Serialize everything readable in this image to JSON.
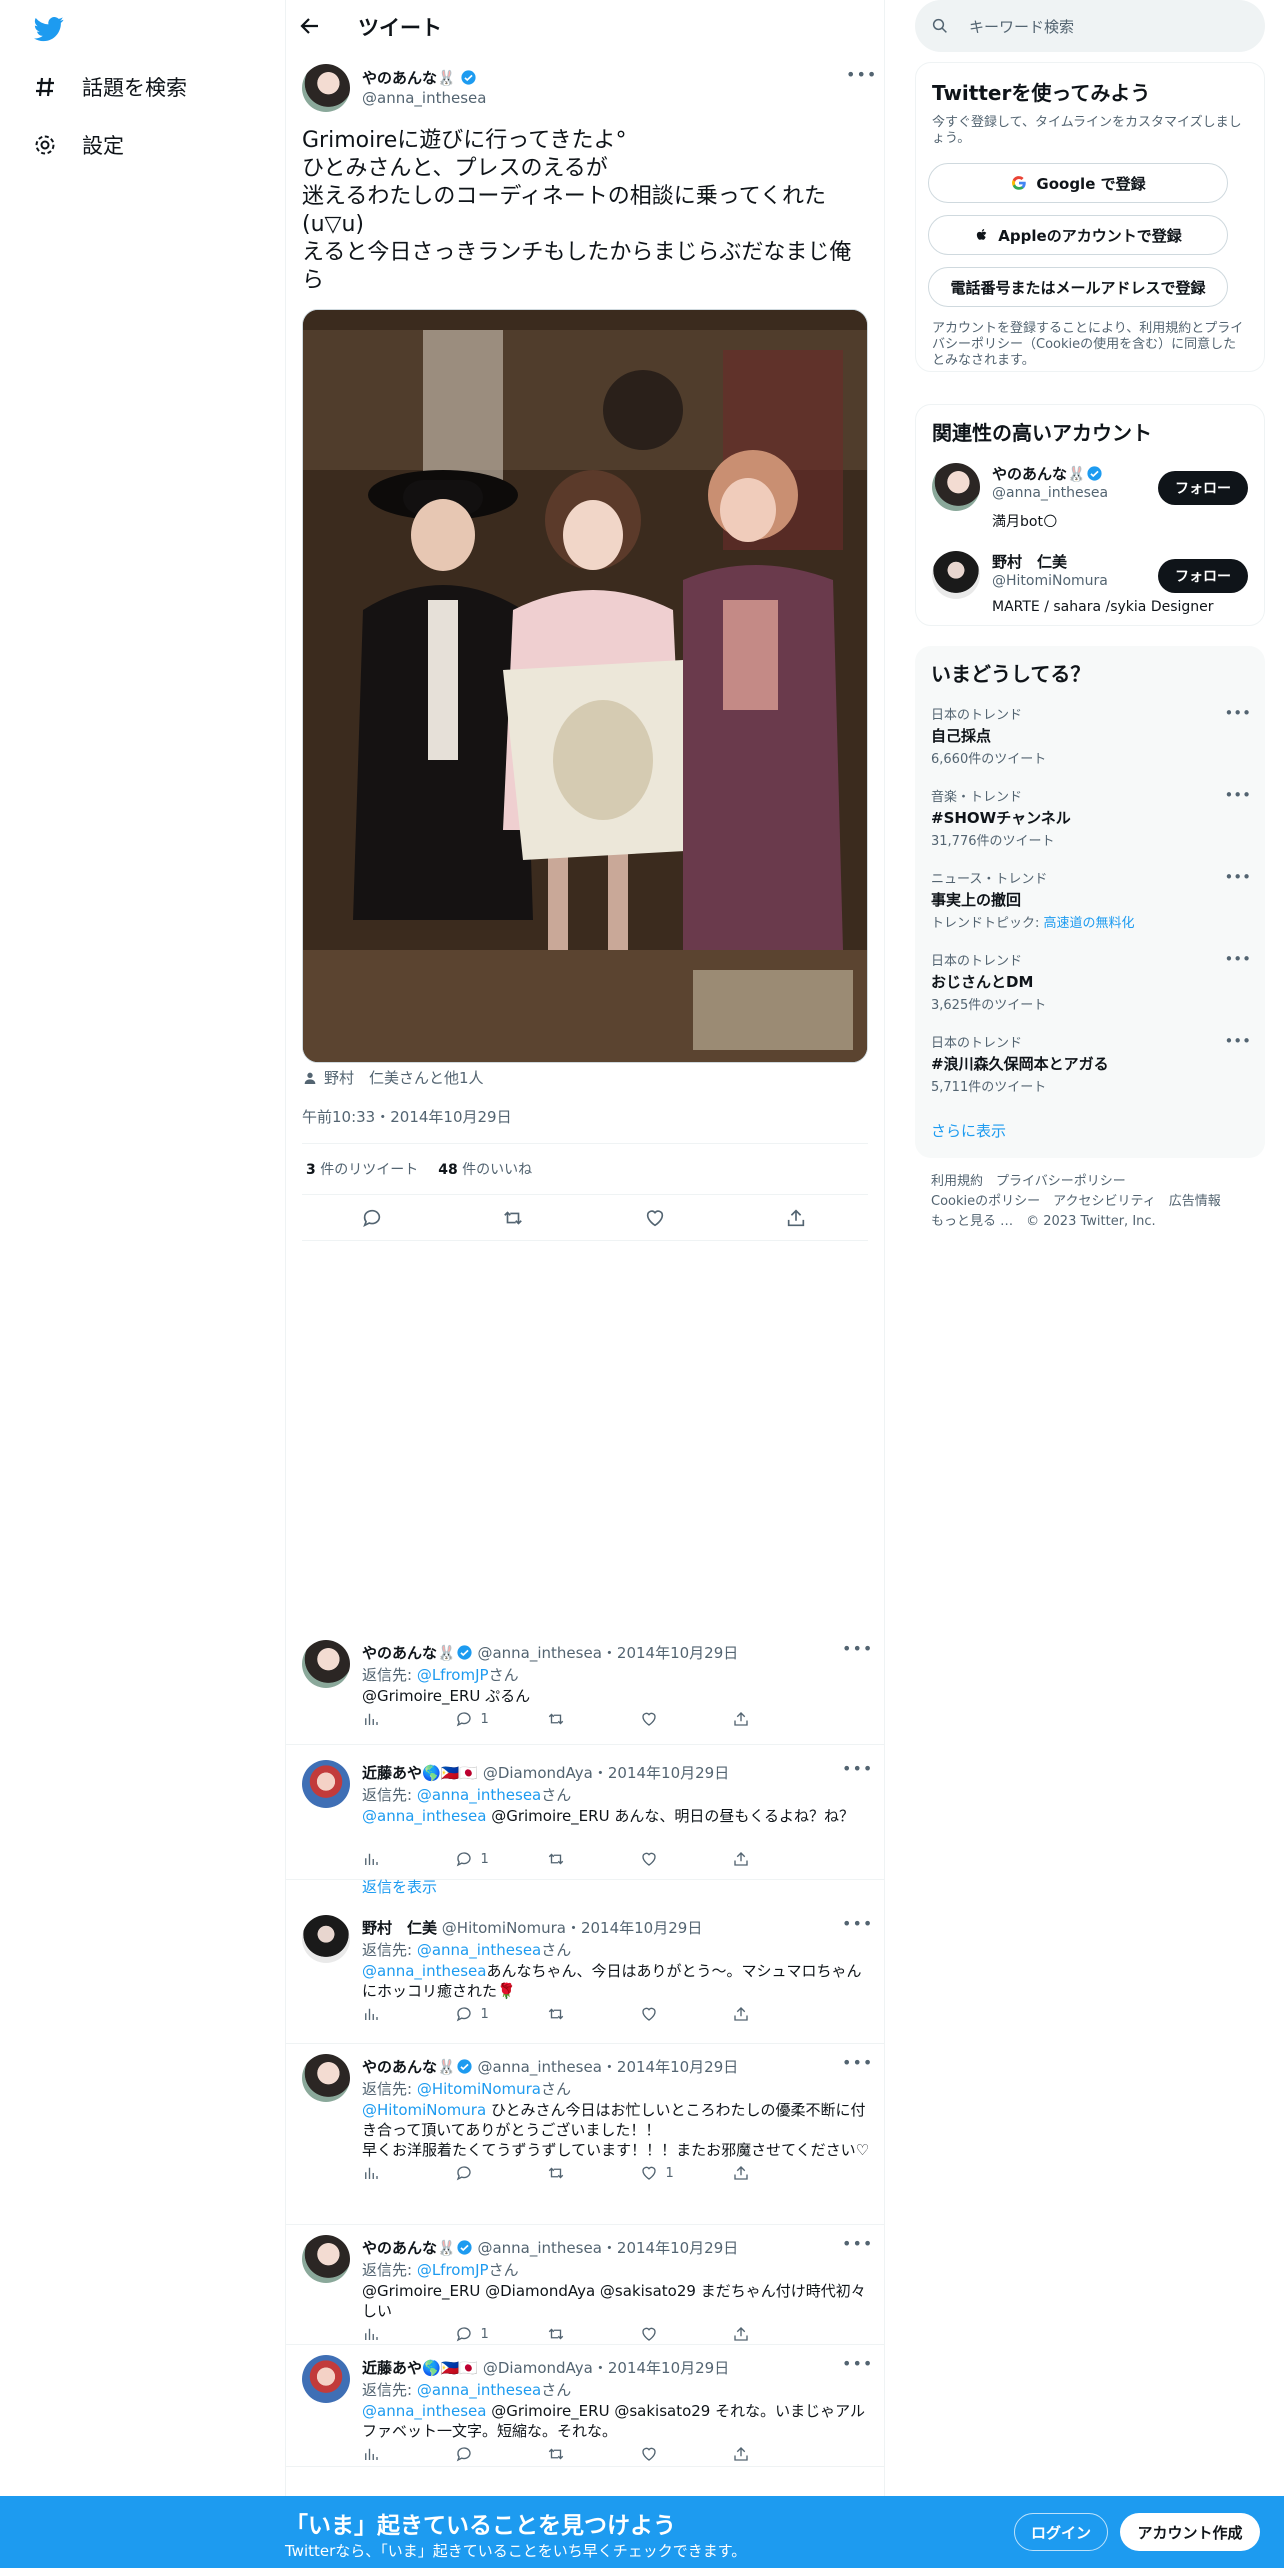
{
  "nav": {
    "explore_label": "話題を検索",
    "settings_label": "設定"
  },
  "header": {
    "title": "ツイート"
  },
  "tweet": {
    "author_name": "やのあんな🐰",
    "author_handle": "@anna_inthesea",
    "text": "Grimoireに遊びに行ってきたよ°\nひとみさんと、プレスのえるが\n迷えるわたしのコーディネートの相談に乗ってくれた(u▽u)\nえると今日さっきランチもしたからまじらぶだなまじ俺ら",
    "tagged": "野村　仁美さんと他1人",
    "time": "午前10:33・2014年10月29日",
    "retweets_count": "3",
    "retweets_label": "件のリツイート",
    "likes_count": "48",
    "likes_label": "件のいいね"
  },
  "replies": [
    {
      "name": "やのあんな🐰",
      "handle": "@anna_inthesea",
      "date": "・2014年10月29日",
      "replyto_prefix": "返信先: ",
      "replyto": "@LfromJP",
      "replyto_suffix": "さん",
      "mention": "",
      "body": "@Grimoire_ERU ぷるん",
      "reply_count": "1",
      "like_count": ""
    },
    {
      "name": "近藤あや🌎🇵🇭🇯🇵",
      "handle": "@DiamondAya",
      "date": "・2014年10月29日",
      "replyto_prefix": "返信先: ",
      "replyto": "@anna_inthesea",
      "replyto_suffix": "さん",
      "mention": "@anna_inthesea",
      "body": " @Grimoire_ERU あんな、明日の昼もくるよね？ね？",
      "reply_count": "1",
      "like_count": ""
    },
    {
      "name": "野村　仁美",
      "handle": "@HitomiNomura",
      "date": "・2014年10月29日",
      "replyto_prefix": "返信先: ",
      "replyto": "@anna_inthesea",
      "replyto_suffix": "さん",
      "mention": "@anna_inthesea",
      "body": "あんなちゃん、今日はありがとう〜。マシュマロちゃんにホッコリ癒された🌹",
      "reply_count": "1",
      "like_count": ""
    },
    {
      "name": "やのあんな🐰",
      "handle": "@anna_inthesea",
      "date": "・2014年10月29日",
      "replyto_prefix": "返信先: ",
      "replyto": "@HitomiNomura",
      "replyto_suffix": "さん",
      "mention": "@HitomiNomura",
      "body": " ひとみさん今日はお忙しいところわたしの優柔不断に付き合って頂いてありがとうございました！！\n早くお洋服着たくてうずうずしています！！！またお邪魔させてください♡",
      "reply_count": "",
      "like_count": "1"
    },
    {
      "name": "やのあんな🐰",
      "handle": "@anna_inthesea",
      "date": "・2014年10月29日",
      "replyto_prefix": "返信先: ",
      "replyto": "@LfromJP",
      "replyto_suffix": "さん",
      "mention": "",
      "body": "@Grimoire_ERU @DiamondAya @sakisato29 まだちゃん付け時代初々しい",
      "reply_count": "1",
      "like_count": ""
    },
    {
      "name": "近藤あや🌎🇵🇭🇯🇵",
      "handle": "@DiamondAya",
      "date": "・2014年10月29日",
      "replyto_prefix": "返信先: ",
      "replyto": "@anna_inthesea",
      "replyto_suffix": "さん",
      "mention": "@anna_inthesea",
      "body": " @Grimoire_ERU @sakisato29 それな。いまじゃアルファベット一文字。短縮な。それな。",
      "reply_count": "",
      "like_count": ""
    }
  ],
  "show_replies": "返信を表示",
  "right": {
    "search_placeholder": "キーワード検索",
    "signup_card": {
      "title": "Twitterを使ってみよう",
      "desc": "今すぐ登録して、タイムラインをカスタマイズしましょう。",
      "google": "Google で登録",
      "apple": "Appleのアカウントで登録",
      "phone": "電話番号またはメールアドレスで登録",
      "terms": "アカウントを登録することにより、利用規約とプライバシーポリシー（Cookieの使用を含む）に同意したとみなされます。"
    },
    "related": {
      "title": "関連性の高いアカウント",
      "accounts": [
        {
          "name": "やのあんな🐰",
          "handle": "@anna_inthesea",
          "bio": "満月bot🌕",
          "follow": "フォロー"
        },
        {
          "name": "野村　仁美",
          "handle": "@HitomiNomura",
          "bio": "MARTE / sahara /sykia Designer",
          "follow": "フォロー"
        }
      ]
    },
    "trends": {
      "title": "いまどうしてる？",
      "items": [
        {
          "cat": "日本のトレンド",
          "name": "自己採点",
          "count": "6,660件のツイート"
        },
        {
          "cat": "音楽・トレンド",
          "name": "#SHOWチャンネル",
          "count": "31,776件のツイート"
        },
        {
          "cat": "ニュース・トレンド",
          "name": "事実上の撤回",
          "count": "トレンドトピック: 高速道の無料化"
        },
        {
          "cat": "日本のトレンド",
          "name": "おじさんとDM",
          "count": "3,625件のツイート"
        },
        {
          "cat": "日本のトレンド",
          "name": "#浪川森久保岡本とアガる",
          "count": "5,711件のツイート"
        }
      ],
      "show_more": "さらに表示"
    },
    "footer": "利用規約　プライバシーポリシー\nCookieのポリシー　アクセシビリティ　広告情報\nもっと見る …　© 2023 Twitter, Inc."
  },
  "bottom": {
    "headline": "「いま」起きていることを見つけよう",
    "sub": "Twitterなら、「いま」起きていることをいち早くチェックできます。",
    "login": "ログイン",
    "signup": "アカウント作成"
  }
}
